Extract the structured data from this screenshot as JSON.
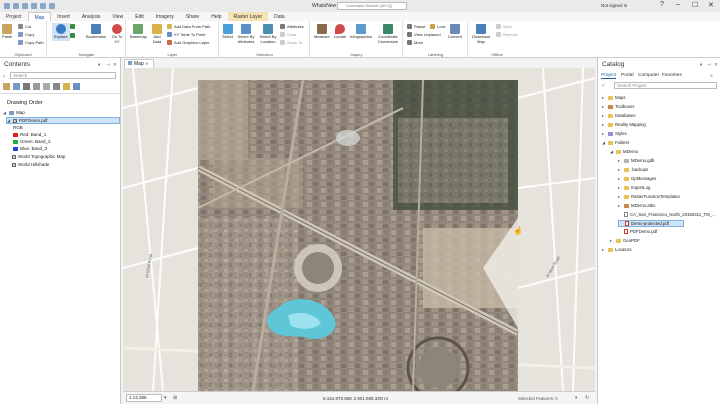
{
  "titlebar": {
    "title": "WhatsNew",
    "search_placeholder": "Command Search (Alt+Q)",
    "signed_in": "Not signed in"
  },
  "tabs": [
    "Project",
    "Map",
    "Insert",
    "Analysis",
    "View",
    "Edit",
    "Imagery",
    "Share",
    "Help",
    "Raster Layer",
    "Data"
  ],
  "ribbon": {
    "clipboard": {
      "paste": "Paste",
      "cut": "Cut",
      "copy": "Copy",
      "copy_path": "Copy Path",
      "label": "Clipboard"
    },
    "navigate": {
      "explore": "Explore",
      "bookmarks": "Bookmarks",
      "goto": "Go To XY",
      "label": "Navigate"
    },
    "layer": {
      "basemap": "Basemap",
      "add_data": "Add Data",
      "add_from_path": "Add Data From Path",
      "xy_table": "XY Table To Point",
      "add_graphics": "Add Graphics Layer",
      "label": "Layer"
    },
    "selection": {
      "select": "Select",
      "by_attributes": "Select By Attributes",
      "by_location": "Select By Location",
      "attributes": "Attributes",
      "clear": "Clear",
      "zoom_to": "Zoom To",
      "label": "Selection"
    },
    "inquiry": {
      "measure": "Measure",
      "locate": "Locate",
      "infographics": "Infographics",
      "coordinate_conversion": "Coordinate Conversion",
      "label": "Inquiry"
    },
    "labeling": {
      "pause": "Pause",
      "lock": "Lock",
      "view_unplaced": "View Unplaced",
      "more": "More",
      "convert": "Convert",
      "label": "Labeling"
    },
    "offline": {
      "download_map": "Download Map",
      "sync": "Sync",
      "remove": "Remove",
      "label": "Offline"
    }
  },
  "contents": {
    "title": "Contents",
    "search_placeholder": "Search",
    "drawing_order": "Drawing Order",
    "layers": [
      {
        "name": "Map",
        "indent": 0
      },
      {
        "name": "PDFDemo.pdf",
        "indent": 1,
        "selected": true
      },
      {
        "name": "RGB",
        "indent": 2
      },
      {
        "name": "Red: Band_1",
        "indent": 2,
        "color": "#e02020"
      },
      {
        "name": "Green: Band_2",
        "indent": 2,
        "color": "#20b040"
      },
      {
        "name": "Blue: Band_3",
        "indent": 2,
        "color": "#2040e0"
      },
      {
        "name": "World Topographic Map",
        "indent": 1
      },
      {
        "name": "World Hillshade",
        "indent": 1
      }
    ]
  },
  "map": {
    "tab_label": "Map",
    "scale": "1:13,386",
    "coordinates": "6,154,878.86E 2,901,989.33N m",
    "selected_features": "Selected Features: 0",
    "road_labels": [
      "Al Khail Road",
      "Al Wasl Road",
      "Al Khail Road"
    ]
  },
  "catalog": {
    "title": "Catalog",
    "tabs": [
      "Project",
      "Portal",
      "Computer",
      "Favorites"
    ],
    "search_placeholder": "Search Project",
    "tree": [
      {
        "name": "Maps",
        "level": 0,
        "kind": "folder"
      },
      {
        "name": "Toolboxes",
        "level": 0,
        "kind": "folder"
      },
      {
        "name": "Databases",
        "level": 0,
        "kind": "folder"
      },
      {
        "name": "Reality Mapping",
        "level": 0,
        "kind": "folder"
      },
      {
        "name": "Styles",
        "level": 0,
        "kind": "folder"
      },
      {
        "name": "Folders",
        "level": 0,
        "kind": "folder",
        "open": true
      },
      {
        "name": "MDemo",
        "level": 1,
        "kind": "folder",
        "open": true
      },
      {
        "name": "MDemo.gdb",
        "level": 2,
        "kind": "db"
      },
      {
        "name": ".backups",
        "level": 2,
        "kind": "folder"
      },
      {
        "name": "GpMessages",
        "level": 2,
        "kind": "folder"
      },
      {
        "name": "ImportLog",
        "level": 2,
        "kind": "folder"
      },
      {
        "name": "RasterFunctionTemplates",
        "level": 2,
        "kind": "folder"
      },
      {
        "name": "MDemo.atbx",
        "level": 2,
        "kind": "toolbox"
      },
      {
        "name": "CA_San_Francisco_North_20150311_TM_...",
        "level": 2,
        "kind": "file"
      },
      {
        "name": "Demo-protected.pdf",
        "level": 2,
        "kind": "file",
        "selected": true
      },
      {
        "name": "PDFDemo.pdf",
        "level": 2,
        "kind": "file"
      },
      {
        "name": "GeoPDF",
        "level": 1,
        "kind": "folder"
      },
      {
        "name": "Locators",
        "level": 0,
        "kind": "folder"
      }
    ]
  }
}
